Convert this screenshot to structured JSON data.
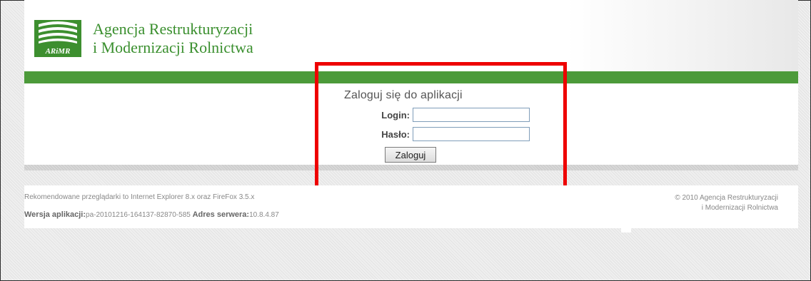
{
  "header": {
    "logo_mark_text": "ARiMR",
    "org_name_line1": "Agencja Restrukturyzacji",
    "org_name_line2": "i Modernizacji Rolnictwa"
  },
  "login": {
    "title": "Zaloguj się do aplikacji",
    "login_label": "Login:",
    "login_value": "",
    "password_label": "Hasło:",
    "password_value": "",
    "submit_label": "Zaloguj"
  },
  "footer": {
    "browsers_note": "Rekomendowane przeglądarki to Internet Explorer 8.x oraz FireFox 3.5.x",
    "version_label": "Wersja aplikacji:",
    "version_value": "pa-20101216-164137-82870-585",
    "server_label": "Adres serwera:",
    "server_value": "10.8.4.87",
    "copyright_line1": "© 2010 Agencja Restrukturyzacji",
    "copyright_line2": "i Modernizacji Rolnictwa"
  },
  "colors": {
    "brand_green": "#4c9a3a",
    "logo_text_green": "#3a8f2e",
    "highlight_red": "#ee0000"
  }
}
